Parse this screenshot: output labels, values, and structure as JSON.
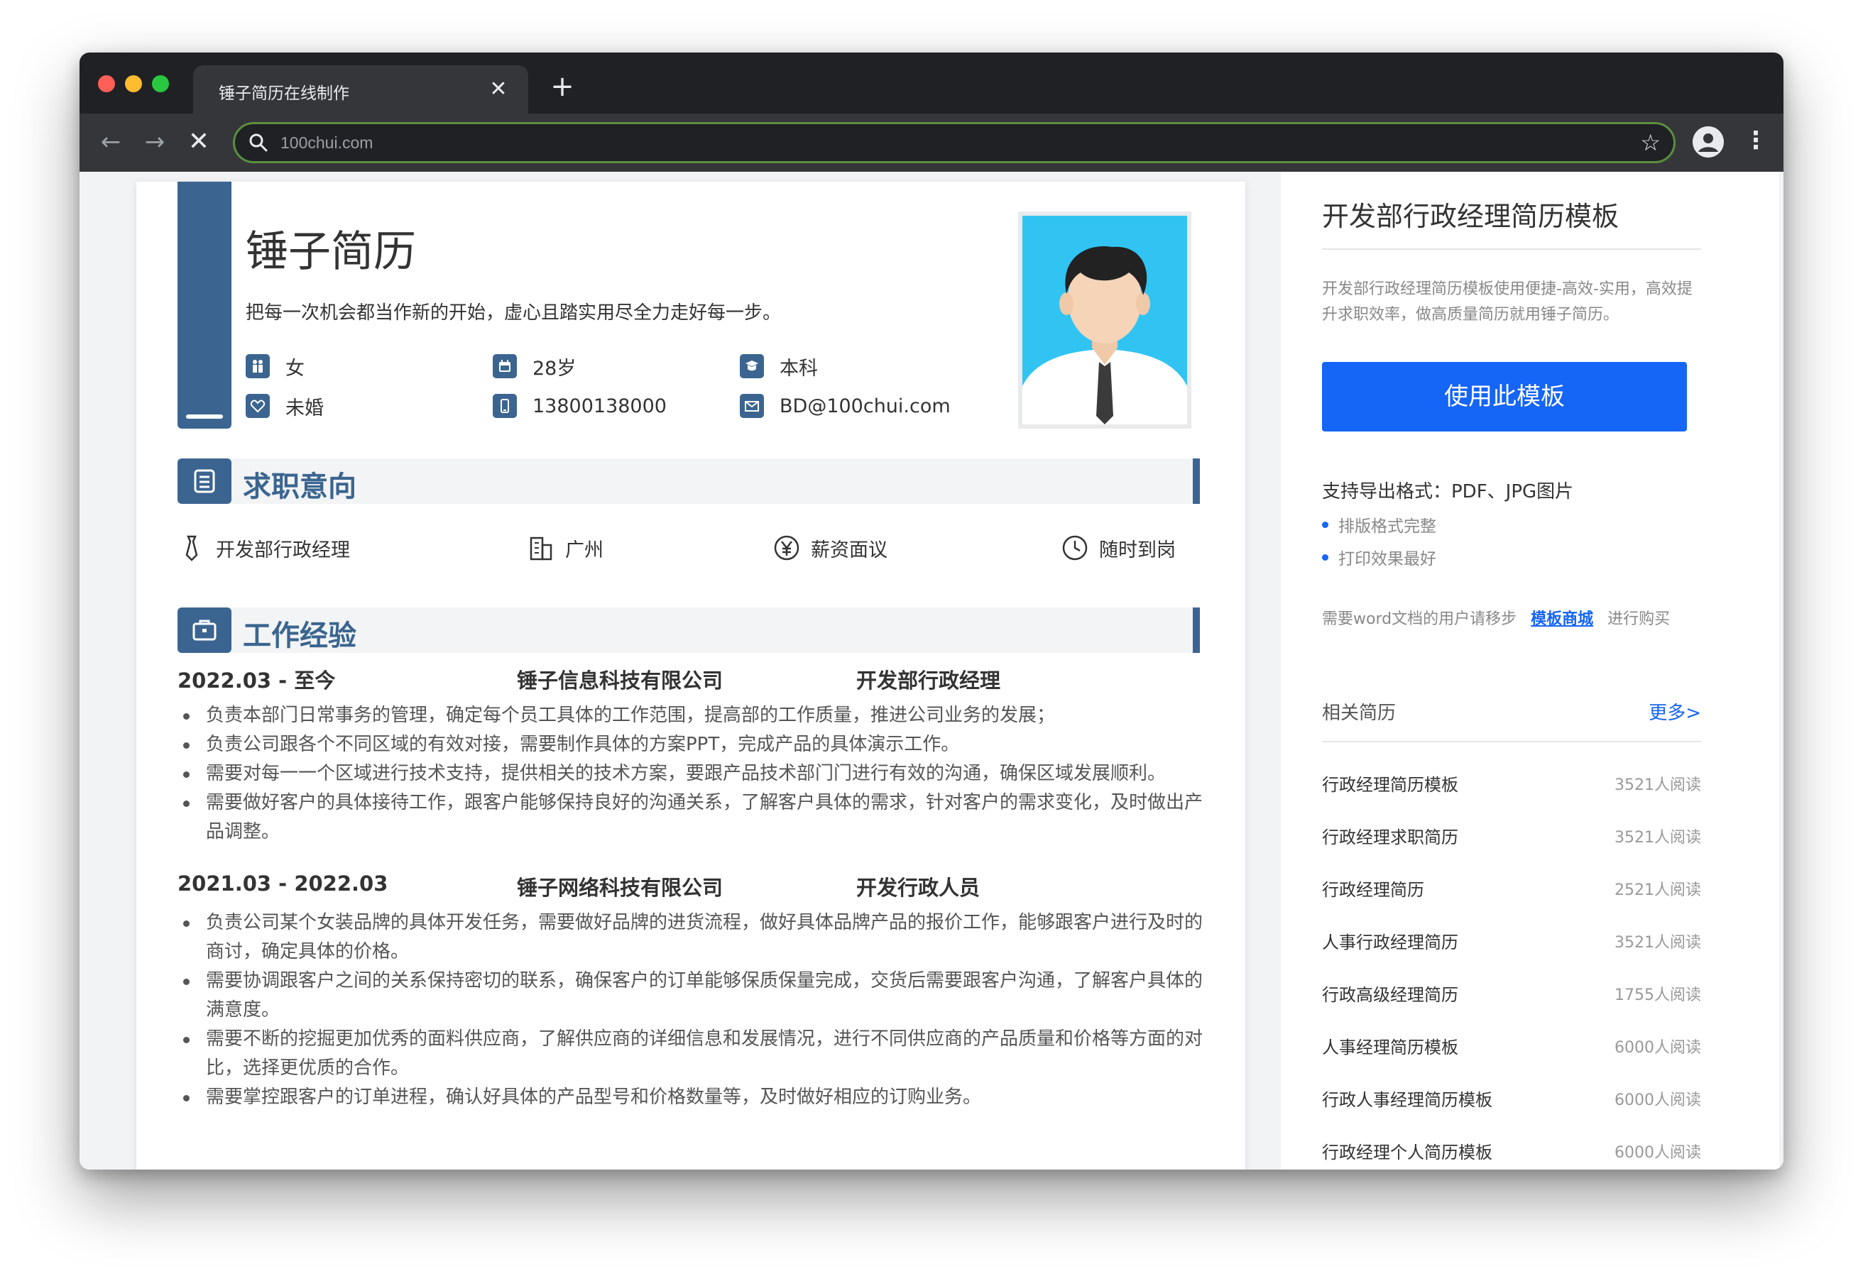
{
  "browser": {
    "tab_title": "锤子简历在线制作",
    "url": "100chui.com"
  },
  "resume": {
    "name": "锤子简历",
    "motto": "把每一次机会都当作新的开始，虚心且踏实用尽全力走好每一步。",
    "info": {
      "gender": "女",
      "age": "28岁",
      "education": "本科",
      "marital": "未婚",
      "phone": "13800138000",
      "email": "BD@100chui.com"
    },
    "sections": {
      "intent_title": "求职意向",
      "work_title": "工作经验"
    },
    "intent": {
      "position": "开发部行政经理",
      "city": "广州",
      "salary": "薪资面议",
      "availability": "随时到岗"
    },
    "jobs": [
      {
        "period": "2022.03 - 至今",
        "company": "锤子信息科技有限公司",
        "role": "开发部行政经理",
        "bullets": [
          "负责本部门日常事务的管理，确定每个员工具体的工作范围，提高部的工作质量，推进公司业务的发展；",
          "负责公司跟各个不同区域的有效对接，需要制作具体的方案PPT，完成产品的具体演示工作。",
          "需要对每一一个区域进行技术支持，提供相关的技术方案，要跟产品技术部门门进行有效的沟通，确保区域发展顺利。",
          "需要做好客户的具体接待工作，跟客户能够保持良好的沟通关系，了解客户具体的需求，针对客户的需求变化，及时做出产品调整。"
        ]
      },
      {
        "period": "2021.03 - 2022.03",
        "company": "锤子网络科技有限公司",
        "role": "开发行政人员",
        "bullets": [
          "负责公司某个女装品牌的具体开发任务，需要做好品牌的进货流程，做好具体品牌产品的报价工作，能够跟客户进行及时的商讨，确定具体的价格。",
          "需要协调跟客户之间的关系保持密切的联系，确保客户的订单能够保质保量完成，交货后需要跟客户沟通，了解客户具体的满意度。",
          "需要不断的挖掘更加优秀的面料供应商，了解供应商的详细信息和发展情况，进行不同供应商的产品质量和价格等方面的对比，选择更优质的合作。",
          "需要掌控跟客户的订单进程，确认好具体的产品型号和价格数量等，及时做好相应的订购业务。"
        ]
      }
    ]
  },
  "sidebar": {
    "title": "开发部行政经理简历模板",
    "description": "开发部行政经理简历模板使用便捷-高效-实用，高效提升求职效率，做高质量简历就用锤子简历。",
    "button_label": "使用此模板",
    "formats": "支持导出格式：PDF、JPG图片",
    "features": [
      "排版格式完整",
      "打印效果最好"
    ],
    "word_prefix": "需要word文档的用户请移步",
    "word_link": "模板商城",
    "word_suffix": "进行购买",
    "related_title": "相关简历",
    "more_label": "更多>",
    "related": [
      {
        "name": "行政经理简历模板",
        "reads": "3521人阅读"
      },
      {
        "name": "行政经理求职简历",
        "reads": "3521人阅读"
      },
      {
        "name": "行政经理简历",
        "reads": "2521人阅读"
      },
      {
        "name": "人事行政经理简历",
        "reads": "3521人阅读"
      },
      {
        "name": "行政高级经理简历",
        "reads": "1755人阅读"
      },
      {
        "name": "人事经理简历模板",
        "reads": "6000人阅读"
      },
      {
        "name": "行政人事经理简历模板",
        "reads": "6000人阅读"
      },
      {
        "name": "行政经理个人简历模板",
        "reads": "6000人阅读"
      }
    ]
  },
  "colors": {
    "accent": "#3b6590",
    "button": "#1565f6",
    "photo_bg": "#31c4f3"
  }
}
